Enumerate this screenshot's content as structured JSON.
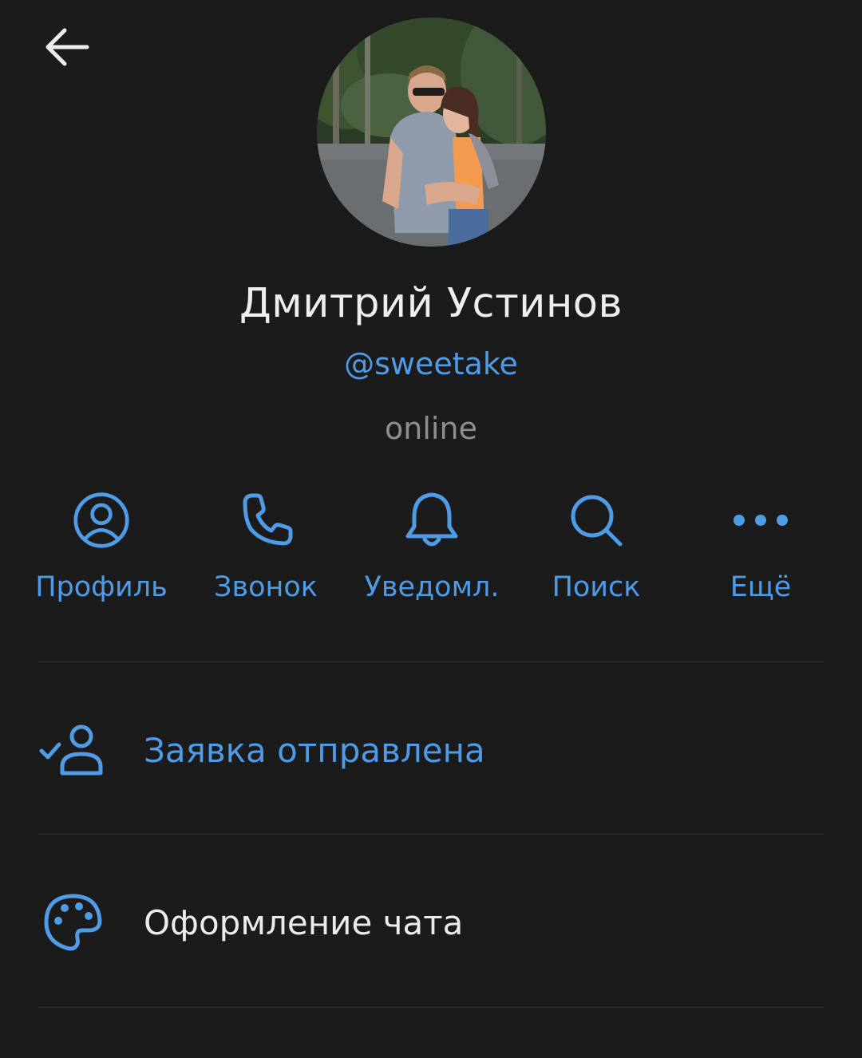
{
  "header": {
    "back_icon": "arrow-left-icon"
  },
  "profile": {
    "name": "Дмитрий Устинов",
    "username": "@sweetake",
    "status": "online"
  },
  "actions": [
    {
      "label": "Профиль",
      "icon": "profile-circle-icon"
    },
    {
      "label": "Звонок",
      "icon": "phone-icon"
    },
    {
      "label": "Уведомл.",
      "icon": "bell-icon"
    },
    {
      "label": "Поиск",
      "icon": "search-icon"
    },
    {
      "label": "Ещё",
      "icon": "more-dots-icon"
    }
  ],
  "rows": [
    {
      "label": "Заявка отправлена",
      "icon": "user-check-icon"
    },
    {
      "label": "Оформление чата",
      "icon": "palette-icon"
    }
  ],
  "colors": {
    "background": "#1b1b1c",
    "accent": "#4f9be6",
    "text": "#ececec",
    "muted": "#8e8e92",
    "divider": "#343436"
  }
}
